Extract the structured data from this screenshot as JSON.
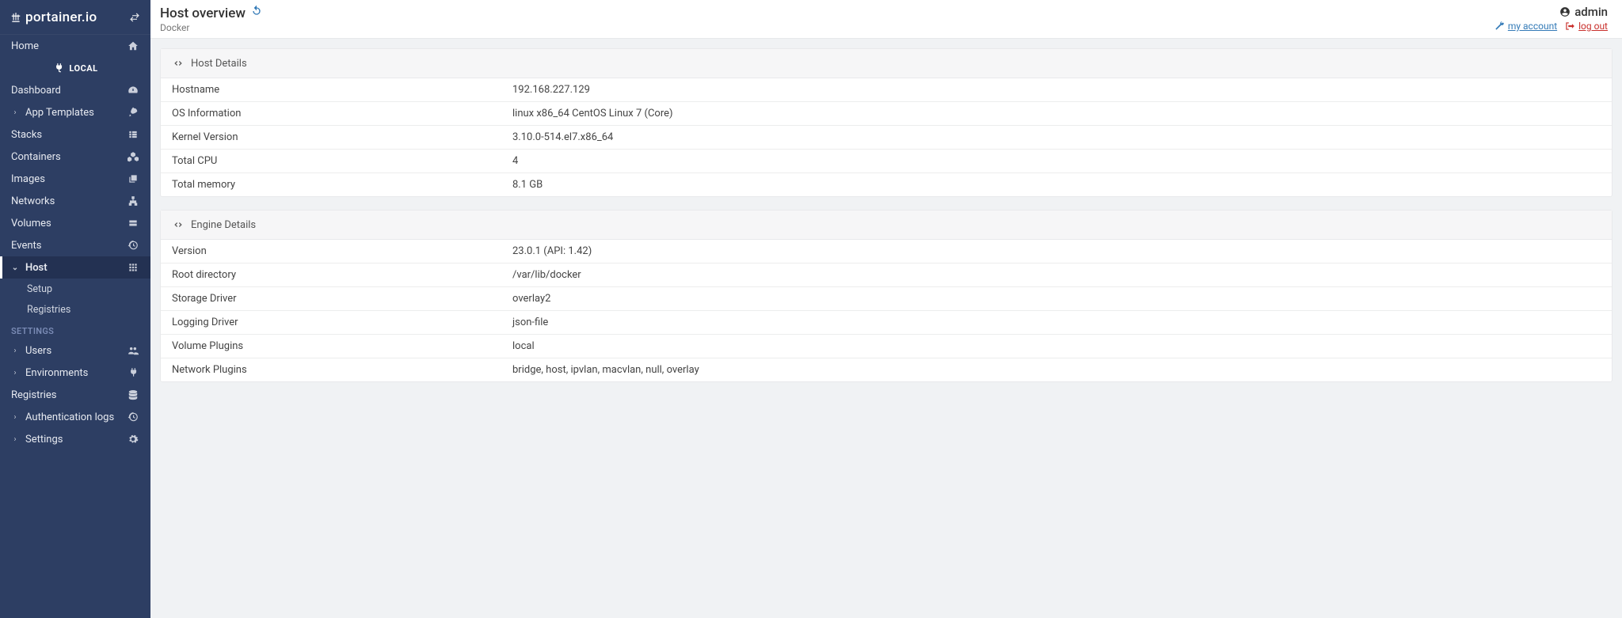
{
  "brand": "portainer.io",
  "header": {
    "title": "Host overview",
    "subtitle": "Docker",
    "user": "admin",
    "my_account": "my account",
    "log_out": "log out"
  },
  "sidebar": {
    "home": "Home",
    "env": "LOCAL",
    "items": {
      "dashboard": "Dashboard",
      "app_templates": "App Templates",
      "stacks": "Stacks",
      "containers": "Containers",
      "images": "Images",
      "networks": "Networks",
      "volumes": "Volumes",
      "events": "Events",
      "host": "Host",
      "host_setup": "Setup",
      "host_registries": "Registries"
    },
    "settings_header": "SETTINGS",
    "settings": {
      "users": "Users",
      "environments": "Environments",
      "registries": "Registries",
      "auth_logs": "Authentication logs",
      "settings": "Settings"
    }
  },
  "panels": {
    "host_details": {
      "title": "Host Details",
      "rows": {
        "hostname_k": "Hostname",
        "hostname_v": "192.168.227.129",
        "os_k": "OS Information",
        "os_v": "linux x86_64 CentOS Linux 7 (Core)",
        "kernel_k": "Kernel Version",
        "kernel_v": "3.10.0-514.el7.x86_64",
        "cpu_k": "Total CPU",
        "cpu_v": "4",
        "mem_k": "Total memory",
        "mem_v": "8.1 GB"
      }
    },
    "engine_details": {
      "title": "Engine Details",
      "rows": {
        "version_k": "Version",
        "version_v": "23.0.1 (API: 1.42)",
        "root_k": "Root directory",
        "root_v": "/var/lib/docker",
        "storage_k": "Storage Driver",
        "storage_v": "overlay2",
        "logging_k": "Logging Driver",
        "logging_v": "json-file",
        "vol_k": "Volume Plugins",
        "vol_v": "local",
        "net_k": "Network Plugins",
        "net_v": "bridge, host, ipvlan, macvlan, null, overlay"
      }
    }
  }
}
